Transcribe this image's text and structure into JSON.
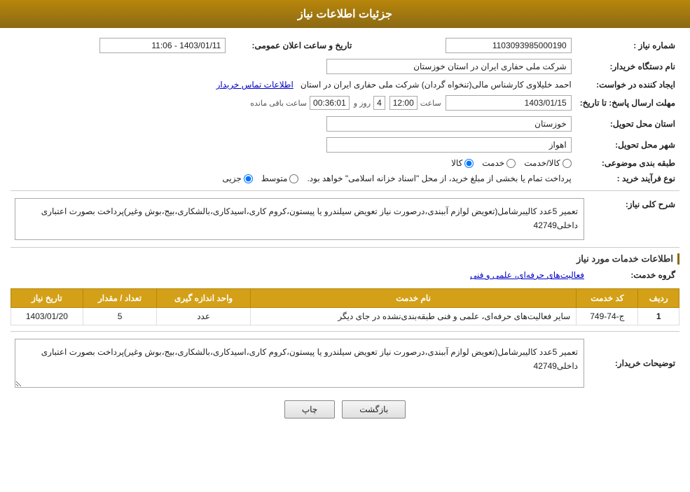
{
  "header": {
    "title": "جزئیات اطلاعات نیاز"
  },
  "fields": {
    "need_number_label": "شماره نیاز :",
    "need_number_value": "1103093985000190",
    "announce_label": "تاریخ و ساعت اعلان عمومی:",
    "announce_value": "1403/01/11 - 11:06",
    "buyer_name_label": "نام دستگاه خریدار:",
    "buyer_name_value": "شرکت ملی حفاری ایران در استان خوزستان",
    "creator_label": "ایجاد کننده در خواست:",
    "creator_value": "احمد خلیلاوی کارشناس مالی(تنخواه گردان) شرکت ملی حفاری ایران در استان",
    "contact_link": "اطلاعات تماس خریدار",
    "deadline_label": "مهلت ارسال پاسخ: تا تاریخ:",
    "deadline_date": "1403/01/15",
    "deadline_time_label": "ساعت",
    "deadline_time_value": "12:00",
    "deadline_day_label": "روز و",
    "deadline_day_value": "4",
    "remaining_label": "ساعت باقی مانده",
    "remaining_value": "00:36:01",
    "province_label": "استان محل تحویل:",
    "province_value": "خوزستان",
    "city_label": "شهر محل تحویل:",
    "city_value": "اهواز",
    "category_label": "طبقه بندی موضوعی:",
    "category_options": [
      "کالا",
      "خدمت",
      "کالا/خدمت"
    ],
    "category_selected": "کالا",
    "purchase_type_label": "نوع فرآیند خرید :",
    "purchase_options": [
      "جزیی",
      "متوسط"
    ],
    "purchase_note": "پرداخت تمام یا بخشی از مبلغ خرید، از محل \"اسناد خزانه اسلامی\" خواهد بود.",
    "description_label": "شرح کلی نیاز:",
    "description_value": "تعمیر 5عدد کالیبرشامل(تعویض لوازم آببندی،درصورت نیاز تعویض سیلندرو یا پیستون،کروم کاری،اسیدکاری،بالشکاری،بیج،بوش وغیر)پرداخت بصورت اعتباری داخلی42749",
    "services_section_label": "اطلاعات خدمات مورد نیاز",
    "service_group_label": "گروه خدمت:",
    "service_group_value": "فعالیت‌های حرفه‌ای، علمی و فنی",
    "table_headers": [
      "ردیف",
      "کد خدمت",
      "نام خدمت",
      "واحد اندازه گیری",
      "تعداد / مقدار",
      "تاریخ نیاز"
    ],
    "table_rows": [
      {
        "row": "1",
        "code": "ج-74-749",
        "name": "سایر فعالیت‌های حرفه‌ای، علمی و فنی طبقه‌بندی‌نشده در جای دیگر",
        "unit": "عدد",
        "qty": "5",
        "date": "1403/01/20"
      }
    ],
    "buyer_desc_label": "توضیحات خریدار:",
    "buyer_desc_value": "تعمیر 5عدد کالیبرشامل(تعویض لوازم آببندی،درصورت نیاز تعویض سیلندرو یا پیستون،کروم کاری،اسیدکاری،بالشکاری،بیج،بوش وغیر)پرداخت بصورت اعتباری داخلی42749"
  },
  "buttons": {
    "print_label": "چاپ",
    "back_label": "بازگشت"
  }
}
